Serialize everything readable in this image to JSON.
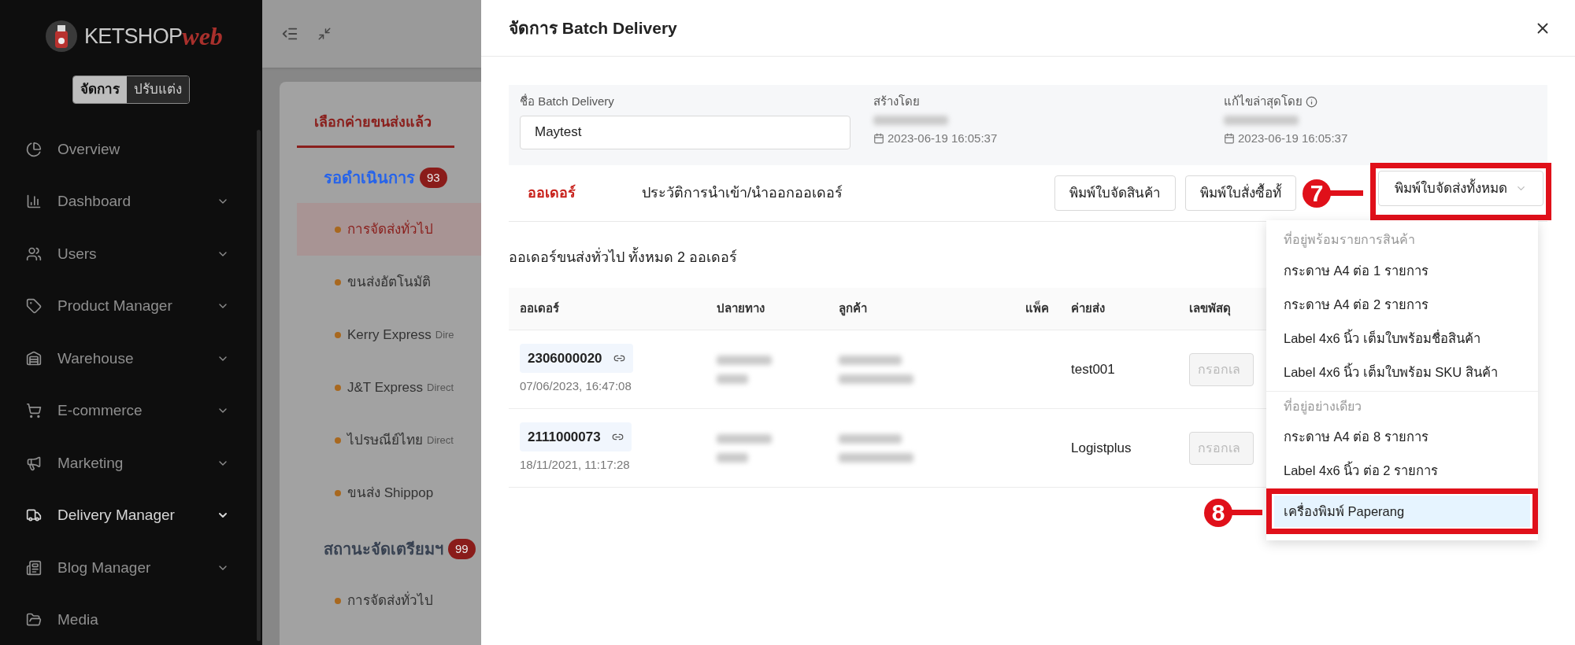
{
  "sidebar": {
    "logo": {
      "main": "KETSHOP",
      "accent": "web"
    },
    "mode_toggle": [
      {
        "label": "จัดการ",
        "selected": true
      },
      {
        "label": "ปรับแต่ง",
        "selected": false
      }
    ],
    "items": [
      {
        "label": "Overview",
        "expandable": false,
        "selected": false
      },
      {
        "label": "Dashboard",
        "expandable": true,
        "selected": false
      },
      {
        "label": "Users",
        "expandable": true,
        "selected": false
      },
      {
        "label": "Product Manager",
        "expandable": true,
        "selected": false
      },
      {
        "label": "Warehouse",
        "expandable": true,
        "selected": false
      },
      {
        "label": "E-commerce",
        "expandable": true,
        "selected": false
      },
      {
        "label": "Marketing",
        "expandable": true,
        "selected": false
      },
      {
        "label": "Delivery Manager",
        "expandable": true,
        "selected": true
      },
      {
        "label": "Blog Manager",
        "expandable": true,
        "selected": false
      },
      {
        "label": "Media",
        "expandable": false,
        "selected": false
      }
    ]
  },
  "background_panel": {
    "tab": "เลือกค่ายขนส่งแล้ว",
    "groups": [
      {
        "title": "รอดำเนินการ",
        "color": "#2563eb",
        "count": "93",
        "items": [
          {
            "label": "การจัดส่งทั่วไป",
            "selected": true
          },
          {
            "label": "ขนส่งอัตโนมัติ",
            "selected": false
          },
          {
            "label": "Kerry Express",
            "note": "Dire",
            "selected": false
          },
          {
            "label": "J&T Express",
            "note": "Direct",
            "selected": false
          },
          {
            "label": "ไปรษณีย์ไทย",
            "note": "Direct",
            "selected": false
          },
          {
            "label": "ขนส่ง Shippop",
            "selected": false
          }
        ]
      },
      {
        "title": "สถานะจัดเตรียมฯ",
        "color": "#374151",
        "count": "99",
        "items": [
          {
            "label": "การจัดส่งทั่วไป",
            "selected": false
          }
        ]
      }
    ]
  },
  "drawer": {
    "title": "จัดการ Batch Delivery",
    "info": {
      "name_label": "ชื่อ Batch Delivery",
      "name_value": "Maytest",
      "created_label": "สร้างโดย",
      "created_at": "2023-06-19 16:05:37",
      "edited_label": "แก้ไขล่าสุดโดย",
      "edited_at": "2023-06-19 16:05:37"
    },
    "tabs": [
      {
        "label": "ออเดอร์",
        "selected": true
      },
      {
        "label": "ประวัติการนำเข้า/นำออกออเดอร์",
        "selected": false
      }
    ],
    "buttons": [
      "พิมพ์ใบจัดสินค้า",
      "พิมพ์ใบสั่งซื้อทั้"
    ],
    "print_all_button": "พิมพ์ใบจัดส่งทั้งหมด",
    "summary": "ออเดอร์ขนส่งทั่วไป ทั้งหมด 2 ออเดอร์",
    "table": {
      "columns": [
        "ออเดอร์",
        "ปลายทาง",
        "ลูกค้า",
        "แพ็ค",
        "ค่ายส่ง",
        "เลขพัสดุ"
      ],
      "rows": [
        {
          "order": "2306000020",
          "date": "07/06/2023, 16:47:08",
          "carrier": "test001",
          "tracking_placeholder": "กรอกเล"
        },
        {
          "order": "2111000073",
          "date": "18/11/2021, 11:17:28",
          "carrier": "Logistplus",
          "tracking_placeholder": "กรอกเล"
        }
      ]
    },
    "dropdown": [
      {
        "kind": "header",
        "label": "ที่อยู่พร้อมรายการสินค้า"
      },
      {
        "kind": "item",
        "label": "กระดาษ A4 ต่อ 1 รายการ",
        "selected": false
      },
      {
        "kind": "item",
        "label": "กระดาษ A4 ต่อ 2 รายการ",
        "selected": false
      },
      {
        "kind": "item",
        "label": "Label 4x6 นิ้ว เต็มใบพร้อมชื่อสินค้า",
        "selected": false
      },
      {
        "kind": "item",
        "label": "Label 4x6 นิ้ว เต็มใบพร้อม SKU สินค้า",
        "selected": false
      },
      {
        "kind": "header",
        "label": "ที่อยู่อย่างเดียว"
      },
      {
        "kind": "item",
        "label": "กระดาษ A4 ต่อ 8 รายการ",
        "selected": false
      },
      {
        "kind": "item",
        "label": "Label 4x6 นิ้ว ต่อ 2 รายการ",
        "selected": false
      },
      {
        "kind": "item",
        "label": "เครื่องพิมพ์ Paperang",
        "selected": true
      }
    ]
  },
  "annotations": [
    {
      "label": "7"
    },
    {
      "label": "8"
    }
  ]
}
